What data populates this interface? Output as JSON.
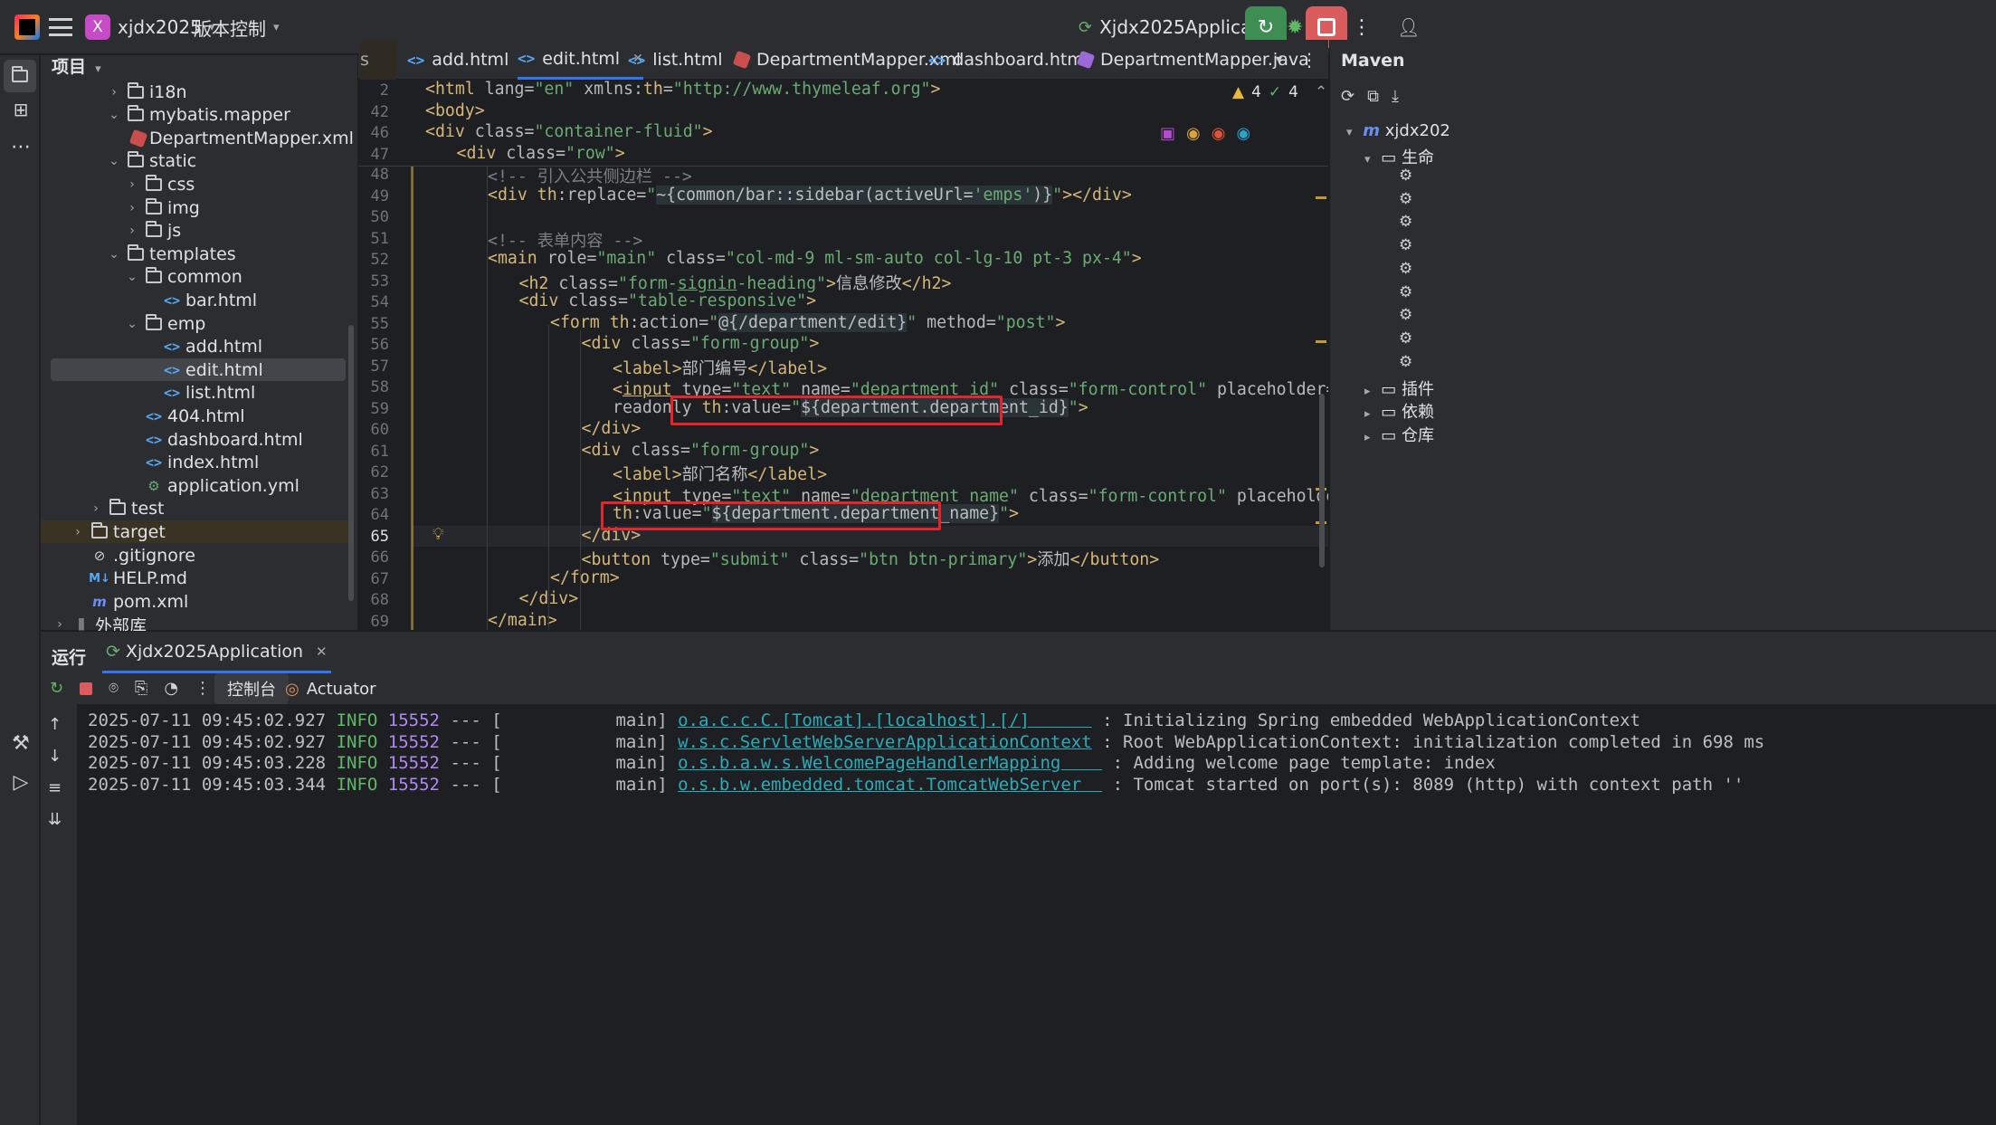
{
  "titlebar": {
    "project_initial": "X",
    "project_name": "xjdx2025",
    "vcs_label": "版本控制",
    "run_config": "Xjdx2025Application"
  },
  "project_panel": {
    "title": "项目",
    "tree": [
      {
        "label": "i18n",
        "type": "folder",
        "level": 3,
        "expanded": false
      },
      {
        "label": "mybatis.mapper",
        "type": "folder",
        "level": 3,
        "expanded": true
      },
      {
        "label": "DepartmentMapper.xml",
        "type": "xml",
        "level": 4
      },
      {
        "label": "static",
        "type": "folder",
        "level": 3,
        "expanded": true
      },
      {
        "label": "css",
        "type": "folder",
        "level": 4,
        "expanded": false
      },
      {
        "label": "img",
        "type": "folder",
        "level": 4,
        "expanded": false
      },
      {
        "label": "js",
        "type": "folder",
        "level": 4,
        "expanded": false
      },
      {
        "label": "templates",
        "type": "folder",
        "level": 3,
        "expanded": true
      },
      {
        "label": "common",
        "type": "folder",
        "level": 4,
        "expanded": true
      },
      {
        "label": "bar.html",
        "type": "html",
        "level": 5
      },
      {
        "label": "emp",
        "type": "folder",
        "level": 4,
        "expanded": true
      },
      {
        "label": "add.html",
        "type": "html",
        "level": 5
      },
      {
        "label": "edit.html",
        "type": "html",
        "level": 5,
        "selected": true
      },
      {
        "label": "list.html",
        "type": "html",
        "level": 5
      },
      {
        "label": "404.html",
        "type": "html",
        "level": 4
      },
      {
        "label": "dashboard.html",
        "type": "html",
        "level": 4
      },
      {
        "label": "index.html",
        "type": "html",
        "level": 4
      },
      {
        "label": "application.yml",
        "type": "yml",
        "level": 4
      },
      {
        "label": "test",
        "type": "folder",
        "level": 2,
        "expanded": false
      },
      {
        "label": "target",
        "type": "folder",
        "level": 1,
        "expanded": false,
        "highlight": true
      },
      {
        "label": ".gitignore",
        "type": "gitignore",
        "level": 1
      },
      {
        "label": "HELP.md",
        "type": "md",
        "level": 1
      },
      {
        "label": "pom.xml",
        "type": "maven",
        "level": 1
      },
      {
        "label": "外部库",
        "type": "lib",
        "level": 0,
        "expanded": false
      }
    ]
  },
  "editor_tabs": [
    {
      "label": "s",
      "icon": "none"
    },
    {
      "label": "add.html",
      "icon": "html"
    },
    {
      "label": "edit.html",
      "icon": "html",
      "active": true,
      "closable": true
    },
    {
      "label": "list.html",
      "icon": "html"
    },
    {
      "label": "DepartmentMapper.xml",
      "icon": "xml"
    },
    {
      "label": "dashboard.html",
      "icon": "html"
    },
    {
      "label": "DepartmentMapper.java",
      "icon": "java"
    }
  ],
  "inspections": {
    "warnings": "4",
    "ok": "4"
  },
  "sticky_lines": [
    {
      "num": "2",
      "html": "<span class='tg'>&lt;html</span> <span class='at'>lang=</span><span class='sv'>\"en\"</span> <span class='at'>xmlns:</span><span class='tg'>th</span><span class='at'>=</span><span class='sv'>\"http://www.thymeleaf.org\"</span><span class='tg'>&gt;</span>",
      "indent": 0
    },
    {
      "num": "42",
      "html": "<span class='tg'>&lt;body&gt;</span>",
      "indent": 0
    },
    {
      "num": "46",
      "html": "<span class='tg'>&lt;div</span> <span class='at'>class=</span><span class='sv'>\"container-fluid\"</span><span class='tg'>&gt;</span>",
      "indent": 0
    },
    {
      "num": "47",
      "html": "<span class='tg'>&lt;div</span> <span class='at'>class=</span><span class='sv'>\"row\"</span><span class='tg'>&gt;</span>",
      "indent": 1
    }
  ],
  "code_lines": [
    {
      "num": "48",
      "indent": 2,
      "html": "<span class='cm'>&lt;!-- 引入公共侧边栏 --&gt;</span>"
    },
    {
      "num": "49",
      "indent": 2,
      "html": "<span class='tg'>&lt;div</span> <span class='tg'>th</span><span class='at'>:replace=</span><span class='sv'>\"</span><span class='ex'>~{common/bar::sidebar(activeUrl=<span class='sv'>'emps'</span>)}</span><span class='sv'>\"</span><span class='tg'>&gt;&lt;/div&gt;</span>"
    },
    {
      "num": "50",
      "indent": 2,
      "html": ""
    },
    {
      "num": "51",
      "indent": 2,
      "html": "<span class='cm'>&lt;!-- 表单内容 --&gt;</span>"
    },
    {
      "num": "52",
      "indent": 2,
      "html": "<span class='tg'>&lt;main</span> <span class='at'>role=</span><span class='sv'>\"main\"</span> <span class='at'>class=</span><span class='sv'>\"col-md-9 ml-sm-auto col-lg-10 pt-3 px-4\"</span><span class='tg'>&gt;</span>"
    },
    {
      "num": "53",
      "indent": 3,
      "html": "<span class='tg'>&lt;h2</span> <span class='at'>class=</span><span class='sv'>\"form-<u>signin</u>-heading\"</span><span class='tg'>&gt;</span><span class='tx'>信息修改</span><span class='tg'>&lt;/h2&gt;</span>"
    },
    {
      "num": "54",
      "indent": 3,
      "html": "<span class='tg'>&lt;div</span> <span class='at'>class=</span><span class='sv'>\"table-responsive\"</span><span class='tg'>&gt;</span>"
    },
    {
      "num": "55",
      "indent": 4,
      "html": "<span class='tg'>&lt;form</span> <span class='tg'>th</span><span class='at'>:action=</span><span class='sv'>\"</span><span class='ex'>@{/department/edit}</span><span class='sv'>\"</span> <span class='at'>method=</span><span class='sv'>\"post\"</span><span class='tg'>&gt;</span>"
    },
    {
      "num": "56",
      "indent": 5,
      "html": "<span class='tg'>&lt;div</span> <span class='at'>class=</span><span class='sv'>\"form-group\"</span><span class='tg'>&gt;</span>"
    },
    {
      "num": "57",
      "indent": 6,
      "html": "<span class='tg'>&lt;label&gt;</span><span class='tx'>部门编号</span><span class='tg'>&lt;/label&gt;</span>"
    },
    {
      "num": "58",
      "indent": 6,
      "html": "<span class='tg'>&lt;<u>input</u></span> <span class='at'>type=</span><span class='sv'>\"text\"</span> <span class='at'>name=</span><span class='sv'>\"department_id\"</span> <span class='at'>class=</span><span class='sv'>\"form-control\"</span> <span class='at'>placeholder=</span><span class='sv'>\"请输入部门编号\"</span>"
    },
    {
      "num": "59",
      "indent": 6,
      "html": "<span class='at'>readonly</span> <span class='tg'>th</span><span class='at'>:value=</span><span class='sv'>\"</span><span class='ex'>${department.department_id}</span><span class='sv'>\"</span><span class='tg'>&gt;</span>"
    },
    {
      "num": "60",
      "indent": 5,
      "html": "<span class='tg'>&lt;/div&gt;</span>"
    },
    {
      "num": "61",
      "indent": 5,
      "html": "<span class='tg'>&lt;div</span> <span class='at'>class=</span><span class='sv'>\"form-group\"</span><span class='tg'>&gt;</span>"
    },
    {
      "num": "62",
      "indent": 6,
      "html": "<span class='tg'>&lt;label&gt;</span><span class='tx'>部门名称</span><span class='tg'>&lt;/label&gt;</span>"
    },
    {
      "num": "63",
      "indent": 6,
      "html": "<span class='tg'>&lt;<u>input</u></span> <span class='at'>type=</span><span class='sv'>\"text\"</span> <span class='at'>name=</span><span class='sv'>\"department_name\"</span> <span class='at'>class=</span><span class='sv'>\"form-control\"</span> <span class='at'>placeholder=</span><span class='sv'>\"请输入部门名称\"</span>"
    },
    {
      "num": "64",
      "indent": 6,
      "html": "<span class='tg'>th</span><span class='at'>:value=</span><span class='sv'>\"</span><span class='ex'>${department.department_name}</span><span class='sv'>\"</span><span class='tg'>&gt;</span>"
    },
    {
      "num": "65",
      "indent": 5,
      "html": "<span class='tg'>&lt;/div&gt;</span>",
      "current": true
    },
    {
      "num": "66",
      "indent": 5,
      "html": "<span class='tg'>&lt;button</span> <span class='at'>type=</span><span class='sv'>\"submit\"</span> <span class='at'>class=</span><span class='sv'>\"btn btn-primary\"</span><span class='tg'>&gt;</span><span class='tx'>添加</span><span class='tg'>&lt;/button&gt;</span>"
    },
    {
      "num": "67",
      "indent": 4,
      "html": "<span class='tg'>&lt;/form&gt;</span>"
    },
    {
      "num": "68",
      "indent": 3,
      "html": "<span class='tg'>&lt;/div&gt;</span>"
    },
    {
      "num": "69",
      "indent": 2,
      "html": "<span class='tg'>&lt;/main&gt;</span>"
    }
  ],
  "maven": {
    "title": "Maven",
    "project": "xjdx202",
    "lifecycle": "生命",
    "plugins": "插件",
    "deps": "依赖",
    "repos": "仓库"
  },
  "run_panel": {
    "title": "运行",
    "tab": "Xjdx2025Application",
    "console_tab": "控制台",
    "actuator_tab": "Actuator",
    "logs": [
      {
        "ts": "2025-07-11 09:45:02.927",
        "level": "INFO",
        "pid": "15552",
        "thread": "--- [           main]",
        "logger": "o.a.c.c.C.[Tomcat].[localhost].[/]      ",
        "msg": ": Initializing Spring embedded WebApplicationContext"
      },
      {
        "ts": "2025-07-11 09:45:02.927",
        "level": "INFO",
        "pid": "15552",
        "thread": "--- [           main]",
        "logger": "w.s.c.ServletWebServerApplicationContext",
        "msg": ": Root WebApplicationContext: initialization completed in 698 ms"
      },
      {
        "ts": "2025-07-11 09:45:03.228",
        "level": "INFO",
        "pid": "15552",
        "thread": "--- [           main]",
        "logger": "o.s.b.a.w.s.WelcomePageHandlerMapping    ",
        "msg": ": Adding welcome page template: index"
      },
      {
        "ts": "2025-07-11 09:45:03.344",
        "level": "INFO",
        "pid": "15552",
        "thread": "--- [           main]",
        "logger": "o.s.b.w.embedded.tomcat.TomcatWebServer  ",
        "msg": ": Tomcat started on port(s): 8089 (http) with context path ''"
      }
    ]
  },
  "colors": {
    "accent": "#3574f0",
    "highlight_box": "#e8232b",
    "run_green": "#3e8e53",
    "stop_red": "#db5c5c"
  }
}
